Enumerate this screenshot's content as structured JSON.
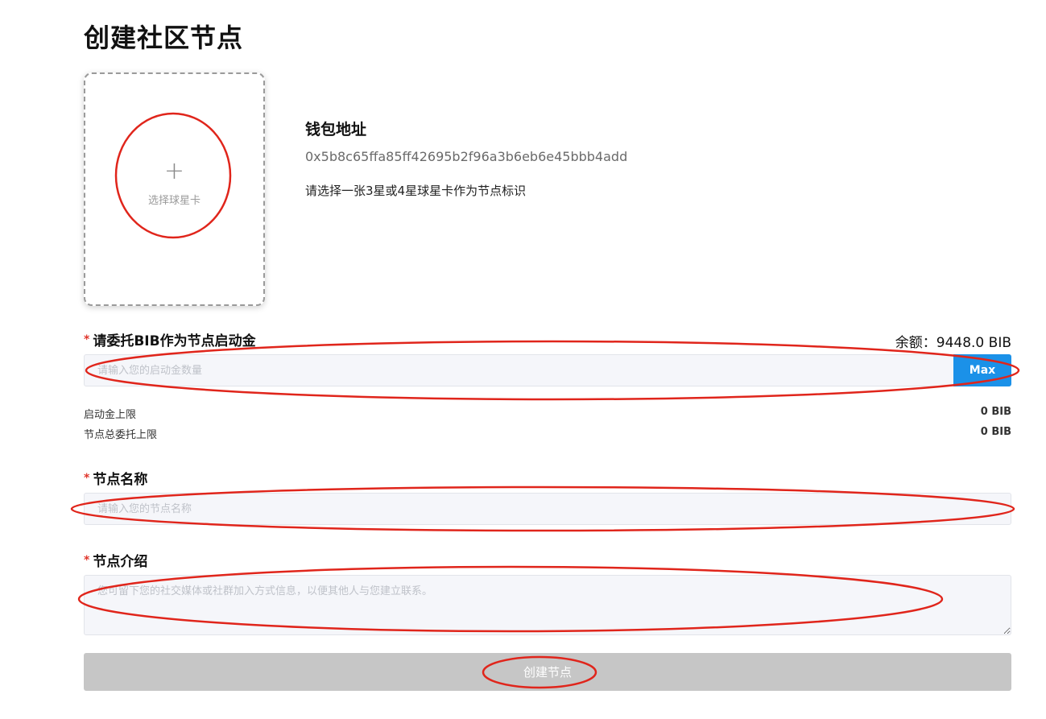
{
  "page": {
    "title": "创建社区节点"
  },
  "card_picker": {
    "plus": "+",
    "label": "选择球星卡"
  },
  "wallet": {
    "title": "钱包地址",
    "address": "0x5b8c65ffa85ff42695b2f96a3b6eb6e45bbb4add",
    "hint": "请选择一张3星或4星球星卡作为节点标识"
  },
  "stake": {
    "required_mark": "*",
    "label": "请委托BIB作为节点启动金",
    "balance": "余额：9448.0 BIB",
    "placeholder": "请输入您的启动金数量",
    "max_label": "Max"
  },
  "limits": [
    {
      "label": "启动金上限",
      "value": "0 BIB"
    },
    {
      "label": "节点总委托上限",
      "value": "0 BIB"
    }
  ],
  "node_name": {
    "required_mark": "*",
    "label": "节点名称",
    "placeholder": "请输入您的节点名称"
  },
  "node_intro": {
    "required_mark": "*",
    "label": "节点介绍",
    "placeholder": "您可留下您的社交媒体或社群加入方式信息，以便其他人与您建立联系。"
  },
  "submit": {
    "label": "创建节点"
  },
  "colors": {
    "accent": "#1b91e8",
    "disabled_button": "#c6c6c6",
    "required": "#e0352b",
    "annotation": "#e0251b"
  }
}
